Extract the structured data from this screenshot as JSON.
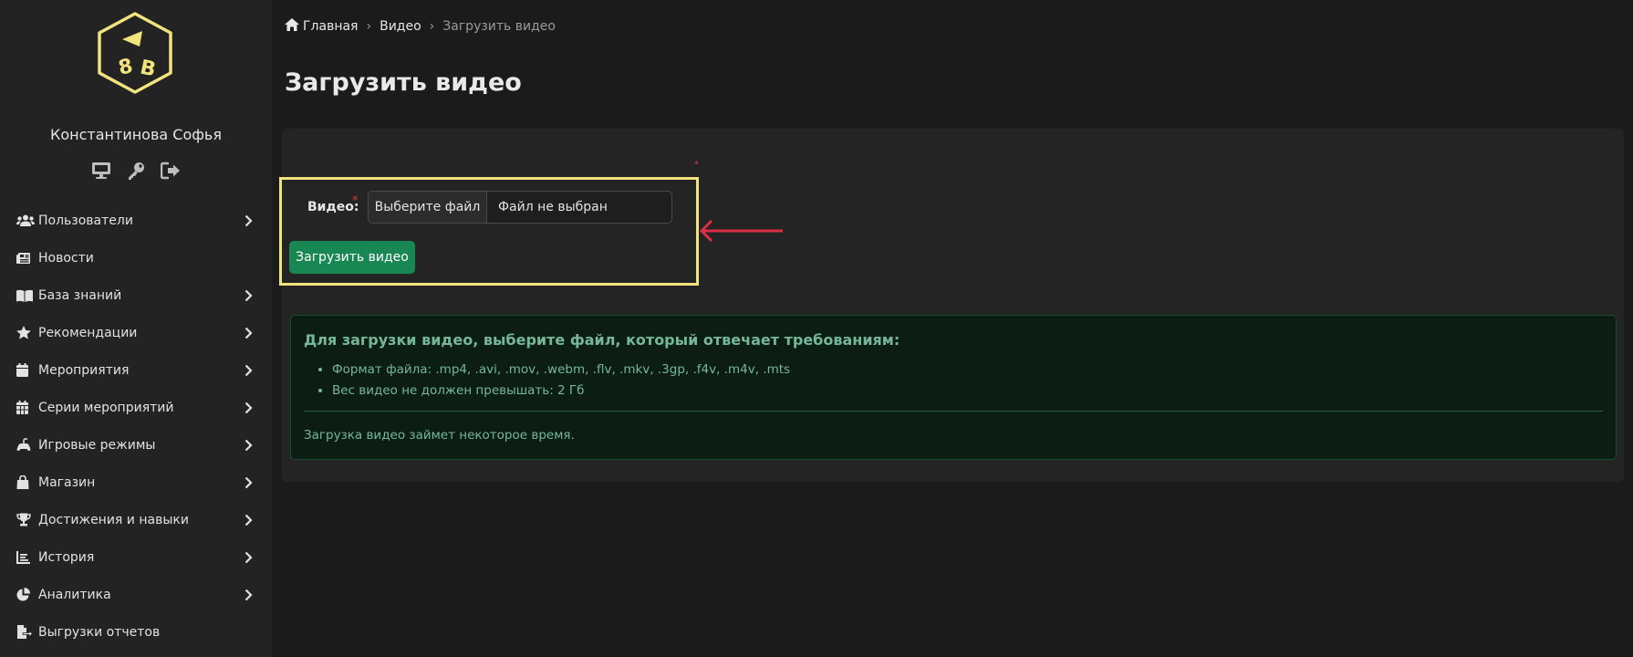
{
  "user": {
    "name": "Константинова Софья",
    "actions": [
      {
        "icon": "desktop-icon"
      },
      {
        "icon": "key-icon"
      },
      {
        "icon": "logout-icon"
      }
    ]
  },
  "sidebar": {
    "items": [
      {
        "label": "Пользователи",
        "icon": "users-icon",
        "has_submenu": true
      },
      {
        "label": "Новости",
        "icon": "newspaper-icon",
        "has_submenu": false
      },
      {
        "label": "База знаний",
        "icon": "book-icon",
        "has_submenu": true
      },
      {
        "label": "Рекомендации",
        "icon": "star-icon",
        "has_submenu": true
      },
      {
        "label": "Мероприятия",
        "icon": "calendar-icon",
        "has_submenu": true
      },
      {
        "label": "Серии мероприятий",
        "icon": "calendar-grid-icon",
        "has_submenu": true
      },
      {
        "label": "Игровые режимы",
        "icon": "gamepad-icon",
        "has_submenu": true
      },
      {
        "label": "Магазин",
        "icon": "shopping-bag-icon",
        "has_submenu": true
      },
      {
        "label": "Достижения и навыки",
        "icon": "trophy-icon",
        "has_submenu": true
      },
      {
        "label": "История",
        "icon": "chart-line-icon",
        "has_submenu": true
      },
      {
        "label": "Аналитика",
        "icon": "pie-chart-icon",
        "has_submenu": true
      },
      {
        "label": "Выгрузки отчетов",
        "icon": "file-export-icon",
        "has_submenu": false
      }
    ]
  },
  "breadcrumb": {
    "home": "Главная",
    "section": "Видео",
    "current": "Загрузить видео",
    "separator": "›"
  },
  "page": {
    "title": "Загрузить видео"
  },
  "form": {
    "video_label": "Видео:",
    "required_mark": "*",
    "file_button": "Выберите файл",
    "file_status": "Файл не выбран",
    "submit": "Загрузить видео"
  },
  "info": {
    "title": "Для загрузки видео, выберите файл, который отвечает требованиям:",
    "requirements": [
      "Формат файла: .mp4, .avi, .mov, .webm, .flv, .mkv, .3gp, .f4v, .m4v, .mts",
      "Вес видео не должен превышать: 2 Гб"
    ],
    "note": "Загрузка видео займет некоторое время."
  },
  "colors": {
    "accent_green": "#198754",
    "highlight_yellow": "#f3e37c",
    "arrow_red": "#dc2f45",
    "logo_yellow": "#f3e37c"
  }
}
